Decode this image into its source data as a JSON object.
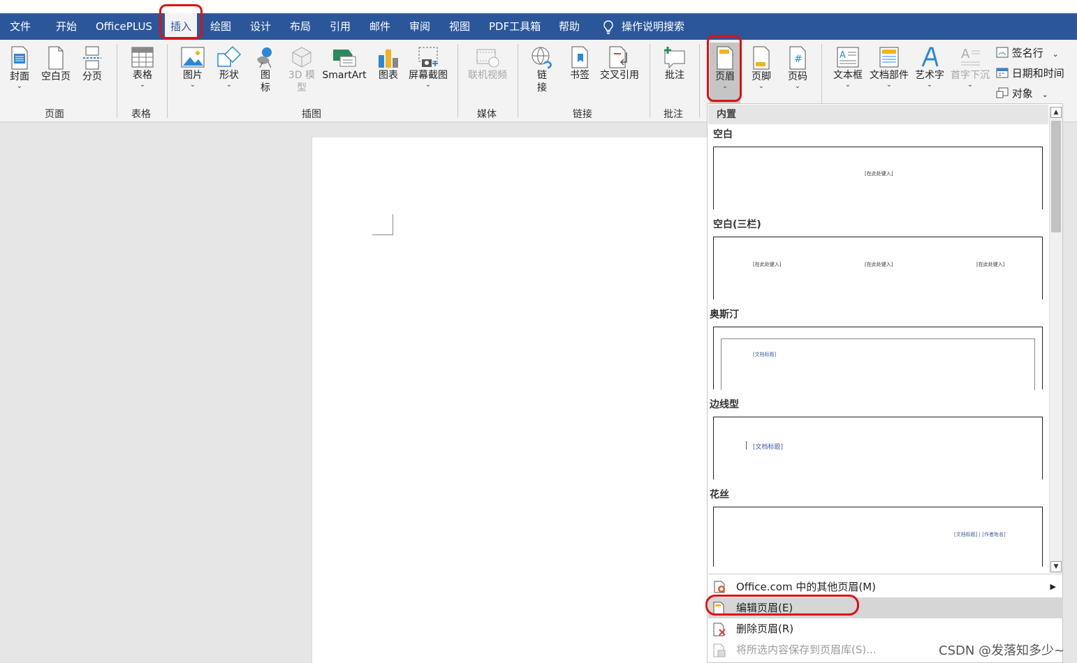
{
  "tabs": [
    "文件",
    "开始",
    "OfficePLUS",
    "插入",
    "绘图",
    "设计",
    "布局",
    "引用",
    "邮件",
    "审阅",
    "视图",
    "PDF工具箱",
    "帮助"
  ],
  "tell_me": "操作说明搜索",
  "ribbon": {
    "cover": "封面",
    "blank_page": "空白页",
    "page_break": "分页",
    "table": "表格",
    "picture": "图片",
    "shapes": "形状",
    "icons_1": "图",
    "icons_2": "标",
    "model3d_1": "3D 模",
    "model3d_2": "型",
    "smartart": "SmartArt",
    "chart": "图表",
    "screenshot": "屏幕截图",
    "online_video": "联机视频",
    "link_1": "链",
    "link_2": "接",
    "bookmark": "书签",
    "cross_ref": "交叉引用",
    "comment": "批注",
    "header": "页眉",
    "footer": "页脚",
    "page_number": "页码",
    "textbox": "文本框",
    "quick_parts": "文档部件",
    "wordart": "艺术字",
    "dropcap": "首字下沉",
    "signature_line": "签名行",
    "date_time": "日期和时间",
    "object": "对象"
  },
  "groups": {
    "pages": "页面",
    "tables": "表格",
    "illustrations": "插图",
    "media": "媒体",
    "links": "链接",
    "comments": "批注"
  },
  "panel": {
    "header": "内置",
    "items": [
      {
        "title": "空白",
        "placeholders": [
          "[在此处键入]"
        ]
      },
      {
        "title": "空白(三栏)",
        "placeholders": [
          "[在此处键入]",
          "[在此处键入]",
          "[在此处键入]"
        ]
      },
      {
        "title": "奥斯汀",
        "placeholders": [
          "[文档标题]"
        ]
      },
      {
        "title": "边线型",
        "placeholders": [
          "[文档标题]"
        ]
      },
      {
        "title": "花丝",
        "placeholders": [
          "[文档标题] | [作者姓名]"
        ]
      }
    ],
    "more_office": "Office.com 中的其他页眉(M)",
    "edit_header": "编辑页眉(E)",
    "remove_header": "删除页眉(R)",
    "save_selection": "将所选内容保存到页眉库(S)..."
  },
  "watermark": "CSDN @发落知多少~",
  "colors": {
    "accent": "#2b579a",
    "annotation": "#e01010"
  }
}
